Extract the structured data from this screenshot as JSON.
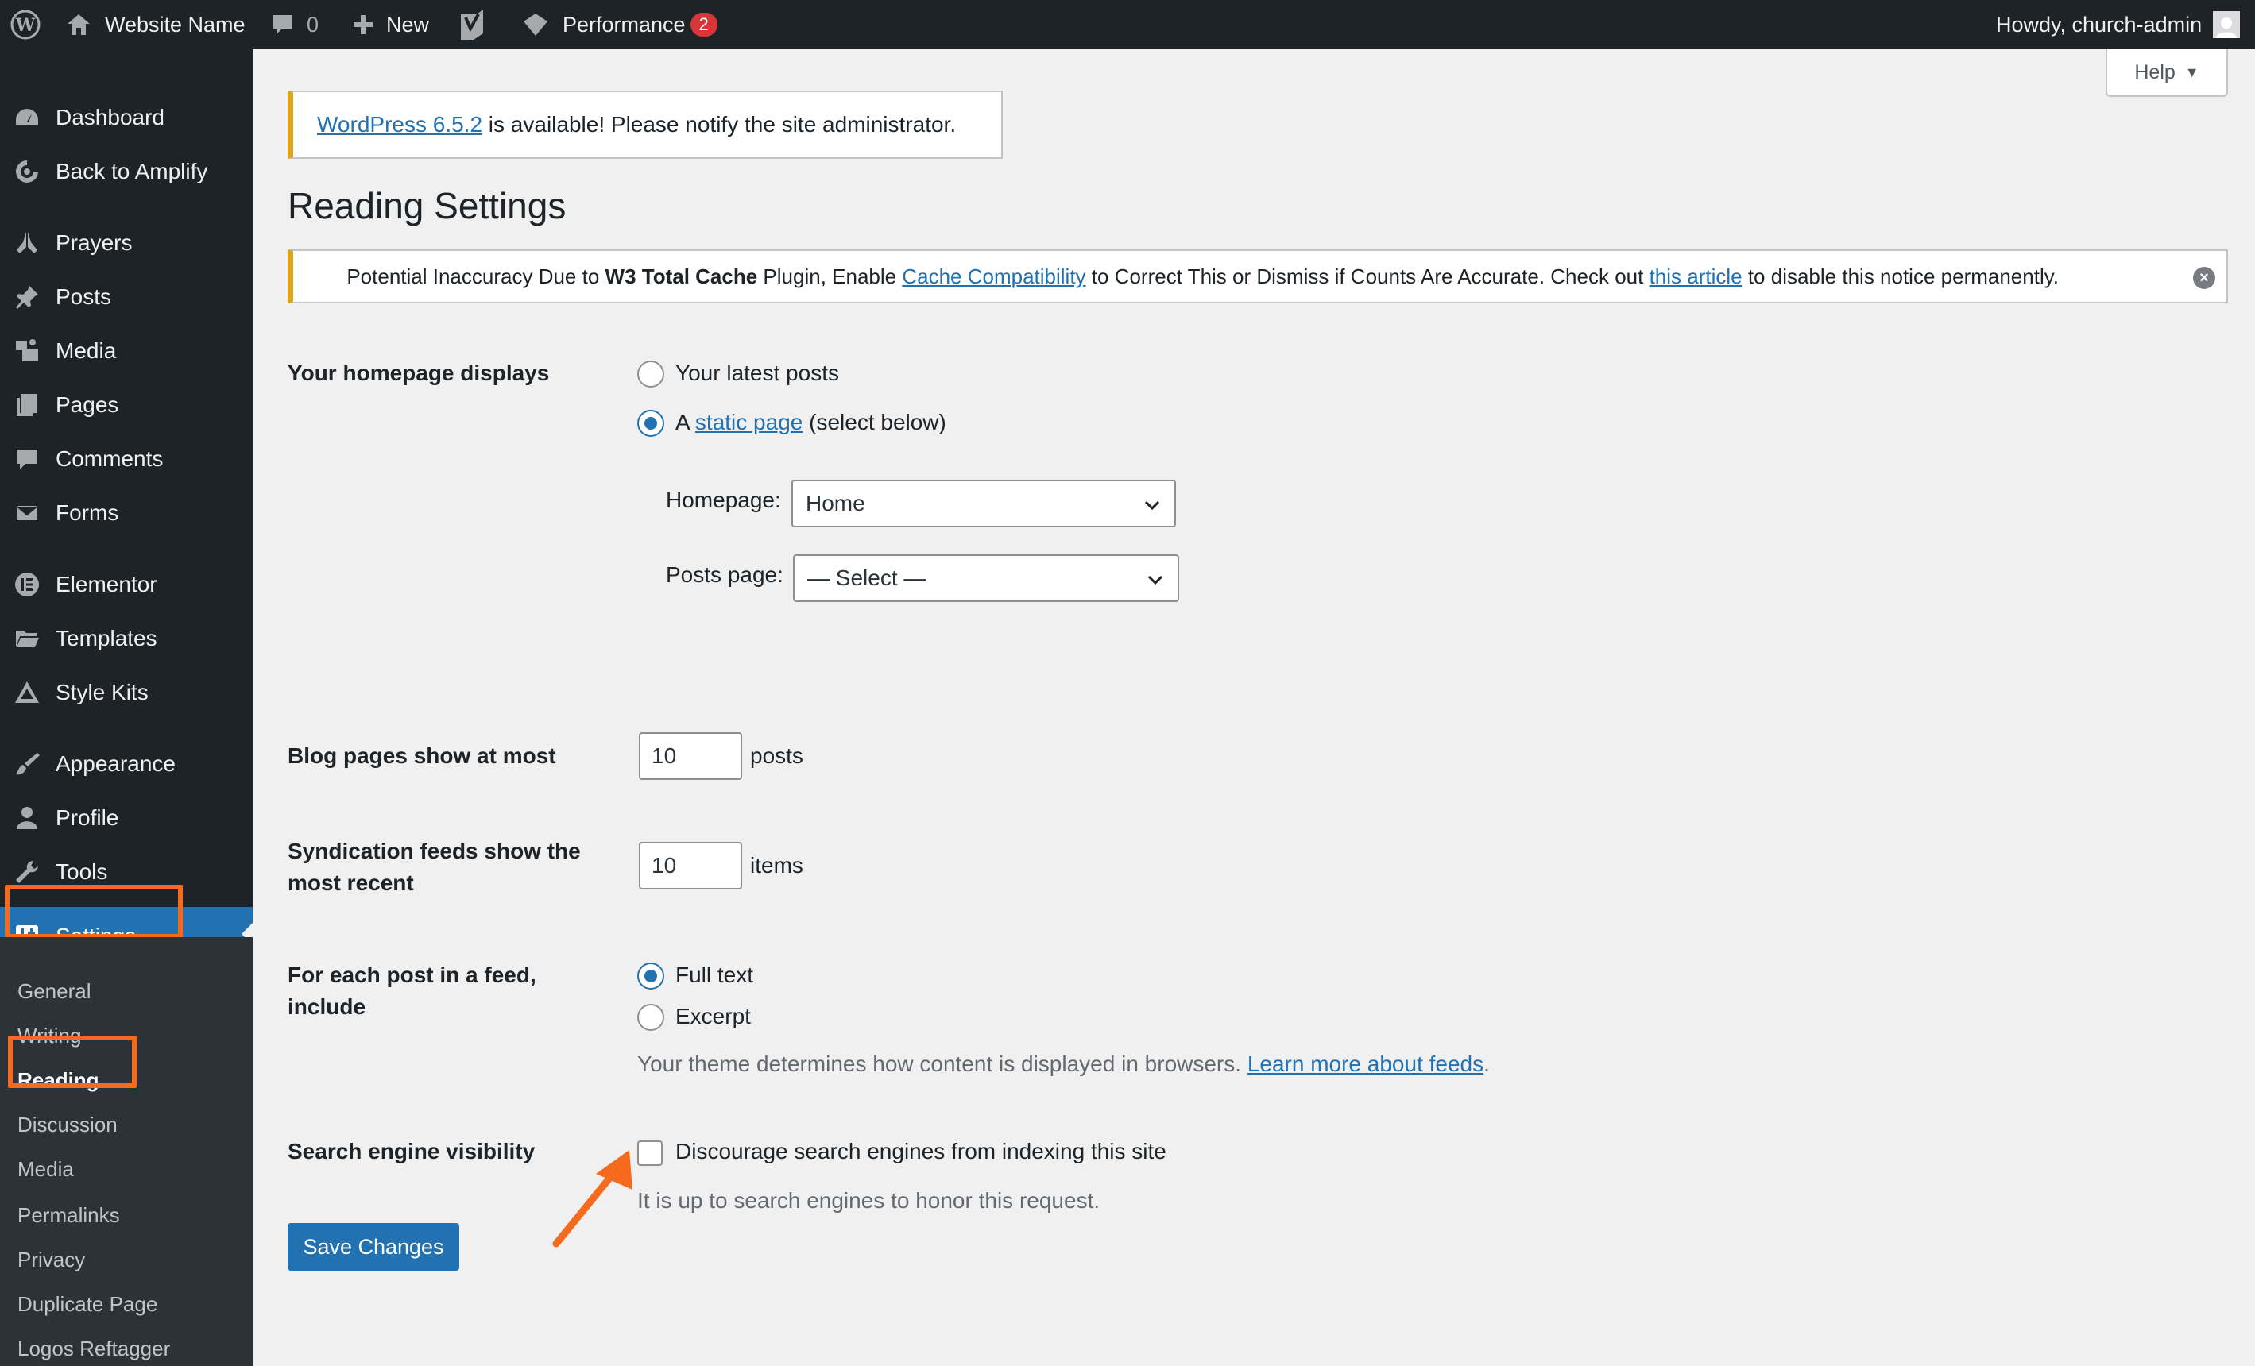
{
  "adminbar": {
    "site_name": "Website Name",
    "comments_count": "0",
    "new_label": "New",
    "performance_label": "Performance",
    "performance_count": "2",
    "howdy": "Howdy, church-admin"
  },
  "sidebar": {
    "items": [
      {
        "label": "Dashboard",
        "icon": "dashboard-icon"
      },
      {
        "label": "Back to Amplify",
        "icon": "amplify-icon"
      },
      {
        "label": "Prayers",
        "icon": "prayer-hands-icon"
      },
      {
        "label": "Posts",
        "icon": "pushpin-icon"
      },
      {
        "label": "Media",
        "icon": "media-icon"
      },
      {
        "label": "Pages",
        "icon": "pages-icon"
      },
      {
        "label": "Comments",
        "icon": "comment-bubble-icon"
      },
      {
        "label": "Forms",
        "icon": "envelope-icon"
      },
      {
        "label": "Elementor",
        "icon": "elementor-icon"
      },
      {
        "label": "Templates",
        "icon": "folder-icon"
      },
      {
        "label": "Style Kits",
        "icon": "triangle-icon"
      },
      {
        "label": "Appearance",
        "icon": "paintbrush-icon"
      },
      {
        "label": "Profile",
        "icon": "user-icon"
      },
      {
        "label": "Tools",
        "icon": "wrench-icon"
      },
      {
        "label": "Settings",
        "icon": "settings-sliders-icon"
      }
    ],
    "submenu": [
      "General",
      "Writing",
      "Reading",
      "Discussion",
      "Media",
      "Permalinks",
      "Privacy",
      "Duplicate Page",
      "Logos Reftagger"
    ]
  },
  "help": {
    "label": "Help"
  },
  "update_notice": {
    "link": "WordPress 6.5.2",
    "text": " is available! Please notify the site administrator."
  },
  "page_title": "Reading Settings",
  "w3_notice": {
    "t1": "Potential Inaccuracy Due to ",
    "bold": "W3 Total Cache",
    "t2": " Plugin, Enable ",
    "link1": "Cache Compatibility",
    "t3": " to Correct This or Dismiss if Counts Are Accurate. Check out ",
    "link2": "this article",
    "t4": " to disable this notice permanently."
  },
  "homepage_displays": {
    "label": "Your homepage displays",
    "opt_latest": "Your latest posts",
    "opt_static_prefix": "A ",
    "opt_static_link": "static page",
    "opt_static_suffix": " (select below)",
    "homepage_label": "Homepage:",
    "homepage_value": "Home",
    "posts_page_label": "Posts page:",
    "posts_page_value": "— Select —"
  },
  "blog_pages": {
    "label": "Blog pages show at most",
    "value": "10",
    "unit": "posts"
  },
  "syndication": {
    "label_line1": "Syndication feeds show the",
    "label_line2": "most recent",
    "value": "10",
    "unit": "items"
  },
  "feed_include": {
    "label_line1": "For each post in a feed,",
    "label_line2": "include",
    "opt_full": "Full text",
    "opt_excerpt": "Excerpt",
    "desc": "Your theme determines how content is displayed in browsers. ",
    "desc_link": "Learn more about feeds",
    "desc_end": "."
  },
  "search_visibility": {
    "label": "Search engine visibility",
    "checkbox_label": "Discourage search engines from indexing this site",
    "desc": "It is up to search engines to honor this request."
  },
  "save_button": "Save Changes",
  "colors": {
    "accent": "#2271b1",
    "highlight": "#f56a1d",
    "notice": "#dba617"
  }
}
